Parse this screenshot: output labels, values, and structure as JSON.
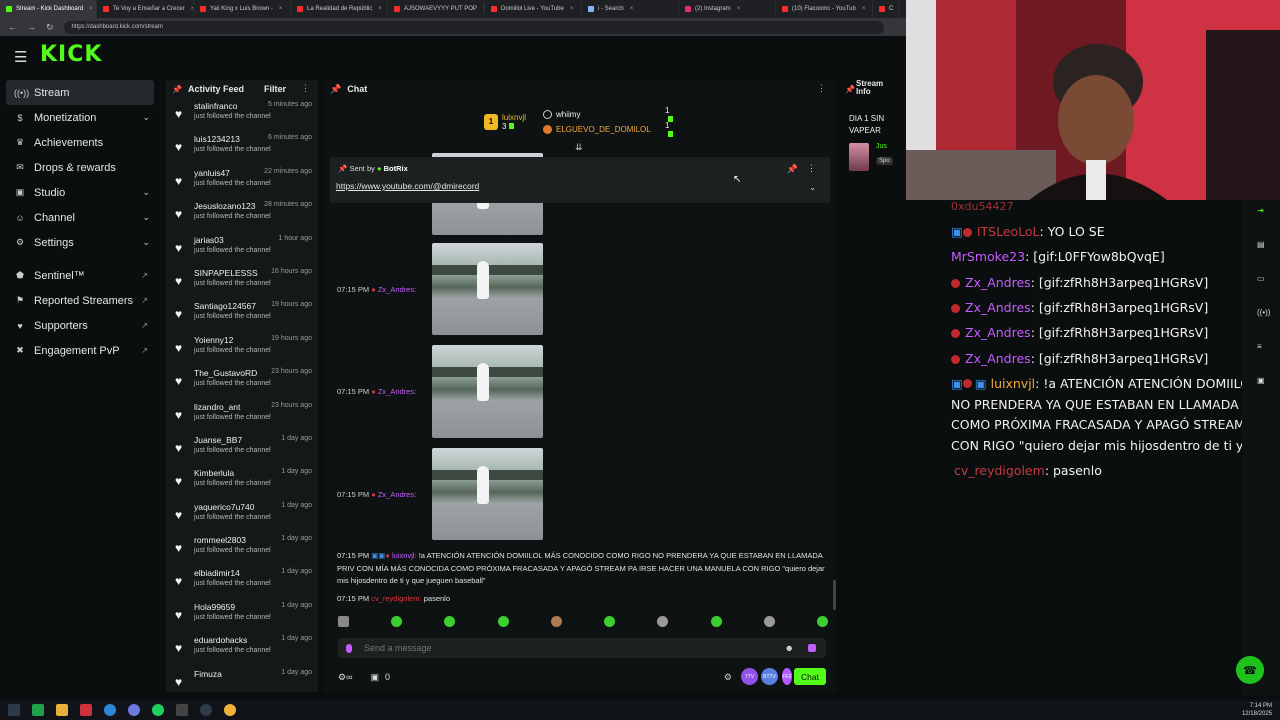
{
  "browser": {
    "tabs": [
      {
        "label": "Stream - Kick Dashboard",
        "color": "#53fc18",
        "active": true
      },
      {
        "label": "Te Voy a Enseñar a Crecer",
        "color": "#ff2b2b"
      },
      {
        "label": "Yaii King x Luis Brown -",
        "color": "#ff2b2b"
      },
      {
        "label": "La Realidad de Repúblic",
        "color": "#ff2b2b"
      },
      {
        "label": "AJSOWAEVYYY PUT POP",
        "color": "#ff2b2b"
      },
      {
        "label": "Domiilol Live - YouTube",
        "color": "#ff2b2b"
      },
      {
        "label": "i - Search",
        "color": "#8ab4f8"
      },
      {
        "label": "(2) Instagram",
        "color": "#e1306c"
      },
      {
        "label": "(10) Flacoomc - YouTub",
        "color": "#ff2b2b"
      },
      {
        "label": "C",
        "color": "#ff2b2b"
      }
    ],
    "url": "https://dashboard.kick.com/stream"
  },
  "logo": "KICK",
  "nav": {
    "items": [
      {
        "label": "Stream",
        "icon": "broadcast-icon",
        "active": true
      },
      {
        "label": "Monetization",
        "icon": "dollar-icon",
        "chevron": true
      },
      {
        "label": "Achievements",
        "icon": "trophy-icon"
      },
      {
        "label": "Drops & rewards",
        "icon": "gift-icon"
      },
      {
        "label": "Studio",
        "icon": "monitor-icon",
        "chevron": true
      },
      {
        "label": "Channel",
        "icon": "user-icon",
        "chevron": true
      },
      {
        "label": "Settings",
        "icon": "gear-icon",
        "chevron": true
      }
    ],
    "external": [
      {
        "label": "Sentinel™",
        "icon": "shield-icon"
      },
      {
        "label": "Reported Streamers",
        "icon": "flag-icon"
      },
      {
        "label": "Supporters",
        "icon": "heart-icon"
      },
      {
        "label": "Engagement PvP",
        "icon": "swords-icon"
      }
    ]
  },
  "feed": {
    "title": "Activity Feed",
    "filter": "Filter",
    "items": [
      {
        "user": "stalinfranco",
        "desc": "just followed the channel",
        "time": "5 minutes ago"
      },
      {
        "user": "luis1234213",
        "desc": "just followed the channel",
        "time": "6 minutes ago"
      },
      {
        "user": "yanluis47",
        "desc": "just followed the channel",
        "time": "22 minutes ago"
      },
      {
        "user": "Jesuslozano123",
        "desc": "just followed the channel",
        "time": "28 minutes ago"
      },
      {
        "user": "jarias03",
        "desc": "just followed the channel",
        "time": "1 hour ago"
      },
      {
        "user": "SINPAPELESSS",
        "desc": "just followed the channel",
        "time": "16 hours ago"
      },
      {
        "user": "Santiago124567",
        "desc": "just followed the channel",
        "time": "19 hours ago"
      },
      {
        "user": "Yoienny12",
        "desc": "just followed the channel",
        "time": "19 hours ago"
      },
      {
        "user": "The_GustavoRD",
        "desc": "just followed the channel",
        "time": "23 hours ago"
      },
      {
        "user": "lizandro_ant",
        "desc": "just followed the channel",
        "time": "23 hours ago"
      },
      {
        "user": "Juanse_BB7",
        "desc": "just followed the channel",
        "time": "1 day ago"
      },
      {
        "user": "Kimberlula",
        "desc": "just followed the channel",
        "time": "1 day ago"
      },
      {
        "user": "yaquerico7u740",
        "desc": "just followed the channel",
        "time": "1 day ago"
      },
      {
        "user": "rommeel2803",
        "desc": "just followed the channel",
        "time": "1 day ago"
      },
      {
        "user": "elbiadimir14",
        "desc": "just followed the channel",
        "time": "1 day ago"
      },
      {
        "user": "Hola99659",
        "desc": "just followed the channel",
        "time": "1 day ago"
      },
      {
        "user": "eduardohacks",
        "desc": "just followed the channel",
        "time": "1 day ago"
      },
      {
        "user": "Fimuza",
        "desc": "",
        "time": "1 day ago"
      }
    ]
  },
  "chat": {
    "title": "Chat",
    "gifters": [
      {
        "user": "luixnvjl",
        "count": "3",
        "rank": "1"
      },
      {
        "user": "whiimy",
        "count": "1"
      },
      {
        "user": "ELGUEVO_DE_DOMILOL",
        "count": "1"
      }
    ],
    "pinned": {
      "sent_by_label": "Sent by",
      "sender": "BotRix",
      "link": "https://www.youtube.com/@dmirecord"
    },
    "gif_messages": [
      {
        "time": "07:15 PM",
        "user": "Zx_Andres:"
      },
      {
        "time": "07:15 PM",
        "user": "Zx_Andres:"
      },
      {
        "time": "07:15 PM",
        "user": "Zx_Andres:"
      }
    ],
    "long_message": {
      "time": "07:15 PM",
      "user": "luixnvjl:",
      "text": "!a ATENCIÓN ATENCIÓN DOMIILOL MÁS CONOCIDO COMO RIGO NO PRENDERA YA QUE ESTABAN EN LLAMADA PRIV CON MÍA MÁS CONOCIDA COMO PRÓXIMA FRACASADA Y APAGÓ STREAM PA IRSE HACER UNA MANUELA CON RIGO \"quiero dejar mis hijosdentro de ti y que jueguen baseball\""
    },
    "last_message": {
      "time": "07:15 PM",
      "user": "cv_reydigolem:",
      "text": "pasenlo"
    },
    "input_placeholder": "Send a message",
    "points": "0",
    "chat_button": "Chat",
    "circle_buttons": [
      "7TV",
      "BTTV",
      "FFZ"
    ]
  },
  "stream_info": {
    "label": "Stream Info",
    "title": "DIA 1 SIN VAPEAR",
    "user_prefix": "Jus",
    "tag": "Spo"
  },
  "overlay": {
    "partial_top": "0xdu54427",
    "lines": [
      {
        "user": "ITSLeoLoL",
        "text": ": YO LO SE"
      },
      {
        "user": "MrSmoke23",
        "text": ": [gif:L0FFYow8bQvqE]"
      },
      {
        "user": "Zx_Andres",
        "text": ": [gif:zfRh8H3arpeq1HGRsV]"
      },
      {
        "user": "Zx_Andres",
        "text": ": [gif:zfRh8H3arpeq1HGRsV]"
      },
      {
        "user": "Zx_Andres",
        "text": ": [gif:zfRh8H3arpeq1HGRsV]"
      },
      {
        "user": "Zx_Andres",
        "text": ": [gif:zfRh8H3arpeq1HGRsV]"
      }
    ],
    "long_user": "luixnvjl",
    "long_lines": [
      ": !a ATENCIÓN ATENCIÓN DOMIILOL M",
      "NO PRENDERA YA QUE ESTABAN EN LLAMADA PRIV",
      "COMO PRÓXIMA FRACASADA Y APAGÓ STREAM PA I",
      "CON RIGO \"quiero dejar mis hijosdentro de ti y que ju"
    ],
    "last_user": "cv_reydigolem",
    "last_text": ": pasenlo"
  },
  "taskbar": {
    "time": "7:14 PM",
    "date": "12/18/2025"
  },
  "colors": {
    "kick_green": "#53fc18",
    "username_purple": "#c55cff",
    "background": "#0b0e0f"
  }
}
